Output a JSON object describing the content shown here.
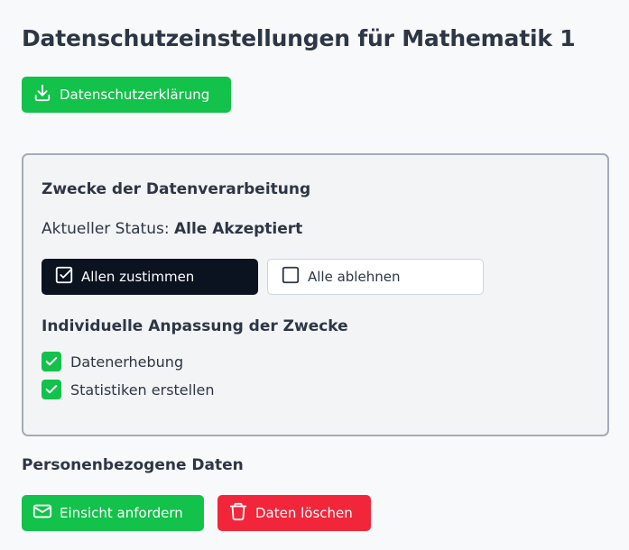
{
  "page": {
    "title": "Datenschutzeinstellungen für Mathematik 1"
  },
  "privacy_button": {
    "label": "Datenschutzerklärung",
    "icon": "download-icon"
  },
  "purposes_panel": {
    "heading": "Zwecke der Datenverarbeitung",
    "status_prefix": "Aktueller Status:",
    "status_value": "Alle Akzeptiert",
    "accept_all_label": "Allen zustimmen",
    "reject_all_label": "Alle ablehnen",
    "individual_heading": "Individuelle Anpassung der Zwecke",
    "purposes": [
      {
        "label": "Datenerhebung",
        "checked": true
      },
      {
        "label": "Statistiken erstellen",
        "checked": true
      }
    ]
  },
  "personal_data": {
    "heading": "Personenbezogene Daten",
    "request_view_label": "Einsicht anfordern",
    "delete_label": "Daten löschen"
  },
  "colors": {
    "green": "#12c24a",
    "red": "#f2263a",
    "dark": "#0b1220",
    "text": "#2d3645",
    "panel_border": "#a3acb8"
  }
}
